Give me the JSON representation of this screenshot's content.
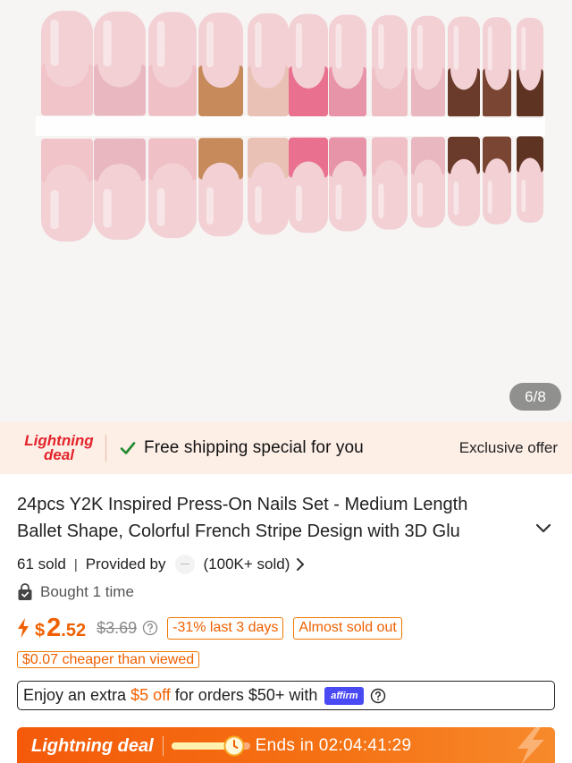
{
  "gallery": {
    "page_counter": "6/8",
    "nail_colors": [
      "#f1c4c9",
      "#e9b7bf",
      "#efc0c6",
      "#c68a5b",
      "#e9c2b5",
      "#e9718f",
      "#e894a8",
      "#efc0c6",
      "#e9b7bf",
      "#6a3a2a",
      "#7a4532",
      "#5e3322"
    ]
  },
  "lightning_strip": {
    "logo_line1": "Lightning",
    "logo_line2": "deal",
    "free_shipping": "Free shipping special for you",
    "exclusive": "Exclusive offer"
  },
  "product": {
    "title_line1": "24pcs Y2K Inspired Press-On Nails Set - Medium Length",
    "title_line2": "Ballet Shape, Colorful French Stripe Design with 3D Glu",
    "sold": "61 sold",
    "provided_by": "Provided by",
    "store_sold": "(100K+ sold)",
    "bought": "Bought 1 time"
  },
  "price": {
    "currency": "$",
    "integer": "2",
    "decimal": ".52",
    "original": "$3.69",
    "discount_tag": "-31% last 3 days",
    "stock_tag": "Almost sold out",
    "cheaper_tag": "$0.07 cheaper than viewed"
  },
  "affirm": {
    "prefix": "Enjoy an extra",
    "highlight": "$5 off",
    "suffix": "for orders $50+ with",
    "logo": "affirm"
  },
  "deal_bar": {
    "label": "Lightning deal",
    "ends_in": "Ends in 02:04:41:29",
    "progress": 0.8
  },
  "colors": {
    "accent_orange": "#f06000",
    "lightning_red": "#e3242b",
    "check_green": "#1f8a2e",
    "affirm_blue": "#4a4af4"
  }
}
